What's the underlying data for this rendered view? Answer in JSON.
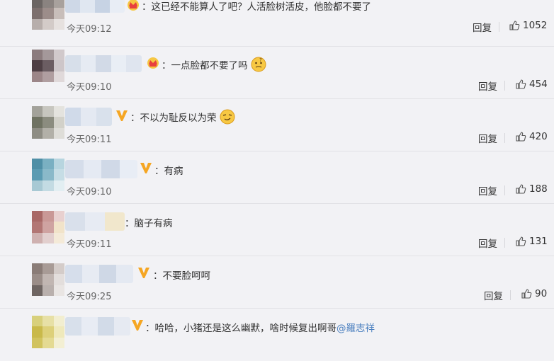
{
  "comments": [
    {
      "badge": "crown",
      "text": "：这已经不能算人了吧？人活脸树活皮，他脸都不要了",
      "time": "今天09:12",
      "reply": "回复",
      "likes": "1052"
    },
    {
      "badge": "crown",
      "text": "：一点脸都不要了吗",
      "emoji": "thinking-emoji",
      "time": "今天09:10",
      "reply": "回复",
      "likes": "454"
    },
    {
      "badge": "v",
      "text": "：不以为耻反以为荣",
      "emoji": "smug-emoji",
      "time": "今天09:11",
      "reply": "回复",
      "likes": "420"
    },
    {
      "badge": "v",
      "text": "：有病",
      "time": "今天09:10",
      "reply": "回复",
      "likes": "188"
    },
    {
      "badge": "none",
      "text": "：脑子有病",
      "time": "今天09:11",
      "reply": "回复",
      "likes": "131"
    },
    {
      "badge": "v",
      "text": "：不要脸呵呵",
      "time": "今天09:25",
      "reply": "回复",
      "likes": "90"
    },
    {
      "badge": "v",
      "text": "：哈哈，小猪还是这么幽默，啥时候复出啊哥",
      "mention": "@羅志祥",
      "time": "",
      "reply": "",
      "likes": ""
    }
  ],
  "colors": {
    "link": "#4a7fbf",
    "badge_gold": "#f5a623",
    "crown_red": "#e8403f"
  }
}
